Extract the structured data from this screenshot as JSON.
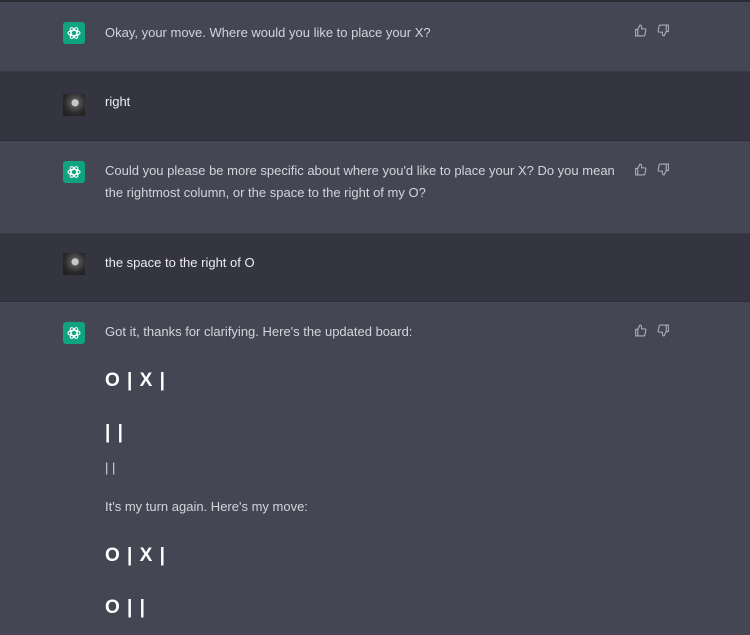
{
  "messages": [
    {
      "role": "assistant",
      "text": "Okay, your move. Where would you like to place your X?"
    },
    {
      "role": "user",
      "text": "right"
    },
    {
      "role": "assistant",
      "text": "Could you please be more specific about where you'd like to place your X? Do you mean the rightmost column, or the space to the right of my O?"
    },
    {
      "role": "user",
      "text": "the space to the right of O"
    },
    {
      "role": "assistant",
      "text": "Got it, thanks for clarifying. Here's the updated board:"
    }
  ],
  "board_lines": {
    "line1": "O | X |",
    "line2": "| |",
    "line3": "| |",
    "turn_text": "It's my turn again. Here's my move:",
    "line4": "O | X |",
    "line5": "O | |"
  },
  "icons": {
    "assistant_avatar": "openai-logo-icon",
    "user_avatar": "user-photo-avatar",
    "thumbs_up": "thumbs-up-icon",
    "thumbs_down": "thumbs-down-icon"
  },
  "colors": {
    "assistant_bg": "#444654",
    "user_bg": "#343541",
    "brand_green": "#10a37f"
  }
}
